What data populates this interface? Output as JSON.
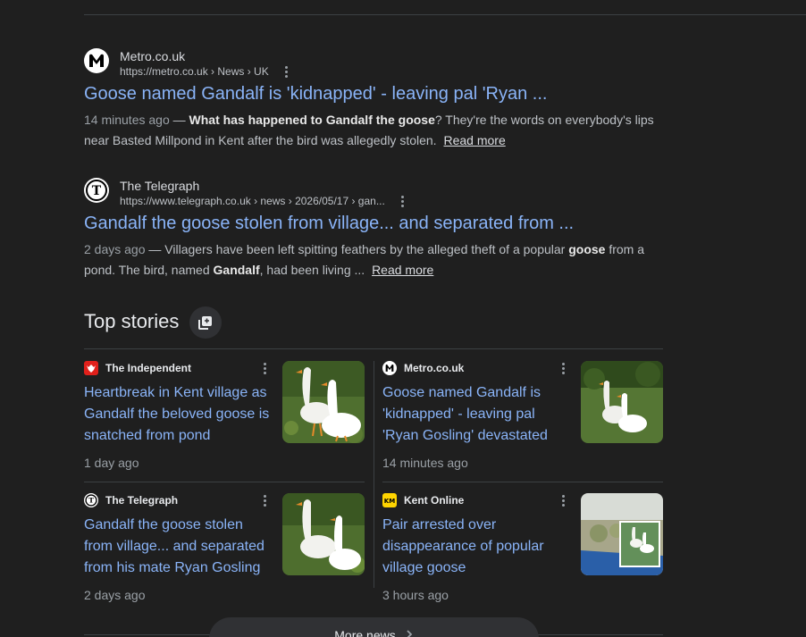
{
  "results": [
    {
      "source": "Metro.co.uk",
      "url": "https://metro.co.uk › News › UK",
      "title": "Goose named Gandalf is 'kidnapped' - leaving pal 'Ryan ...",
      "date": "14 minutes ago",
      "dash": " — ",
      "s1": "What has happened to Gandalf the goose",
      "s2": "? They're the words on everybody's lips near Basted Millpond in Kent after the bird was allegedly stolen.",
      "read_more": "Read more"
    },
    {
      "source": "The Telegraph",
      "url": "https://www.telegraph.co.uk › news › 2026/05/17 › gan...",
      "title": "Gandalf the goose stolen from village... and separated from ...",
      "date": "2 days ago",
      "dash": " — ",
      "s1": "Villagers have been left spitting feathers by the alleged theft of a popular ",
      "b1": "goose",
      "s2": " from a pond. The bird, named ",
      "b2": "Gandalf",
      "s3": ", had been living ...",
      "read_more": "Read more"
    }
  ],
  "top_stories": {
    "title": "Top stories",
    "cards": [
      {
        "source": "The Independent",
        "title": "Heartbreak in Kent village as Gandalf the beloved goose is snatched from pond",
        "time": "1 day ago"
      },
      {
        "source": "Metro.co.uk",
        "title": "Goose named Gandalf is 'kidnapped' - leaving pal 'Ryan Gosling' devastated",
        "time": "14 minutes ago"
      },
      {
        "source": "The Telegraph",
        "title": "Gandalf the goose stolen from village... and separated from his mate Ryan Gosling",
        "time": "2 days ago"
      },
      {
        "source": "Kent Online",
        "title": "Pair arrested over disappearance of popular village goose",
        "time": "3 hours ago"
      }
    ],
    "more_news": "More news"
  },
  "icons": {
    "metro": "metro-logo-icon",
    "telegraph": "telegraph-logo-icon",
    "independent": "independent-eagle-icon",
    "kent": "kent-online-icon",
    "kebab": "more-options-icon",
    "stories": "stories-icon",
    "chevron": "chevron-right-icon"
  },
  "colors": {
    "background": "#1f1f1f",
    "link": "#8ab4f8",
    "independent": "#e0201b",
    "kent": "#ffd400"
  }
}
